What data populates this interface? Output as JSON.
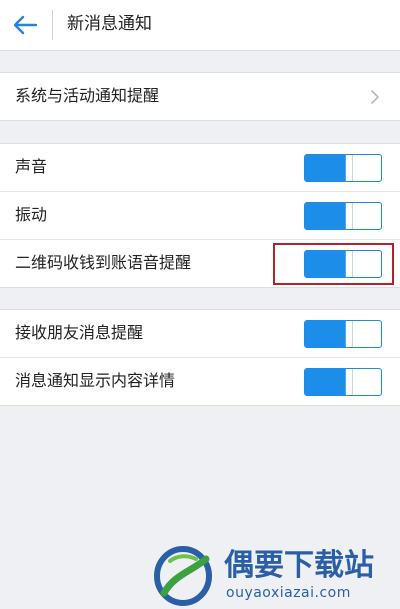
{
  "header": {
    "title": "新消息通知",
    "back_icon": "arrow-left-icon"
  },
  "groups": [
    {
      "rows": [
        {
          "label": "系统与活动通知提醒",
          "type": "link",
          "icon": "chevron-right-icon"
        }
      ]
    },
    {
      "rows": [
        {
          "label": "声音",
          "type": "toggle",
          "on": true
        },
        {
          "label": "振动",
          "type": "toggle",
          "on": true
        },
        {
          "label": "二维码收钱到账语音提醒",
          "type": "toggle",
          "on": true,
          "highlighted": true
        }
      ]
    },
    {
      "rows": [
        {
          "label": "接收朋友消息提醒",
          "type": "toggle",
          "on": true
        },
        {
          "label": "消息通知显示内容详情",
          "type": "toggle",
          "on": true
        }
      ]
    }
  ],
  "watermark": {
    "title": "偶要下载站",
    "url": "ouyaoxiazai.com"
  },
  "colors": {
    "accent": "#1c8de8",
    "highlight_border": "#b3222b",
    "background": "#eff0f4"
  }
}
